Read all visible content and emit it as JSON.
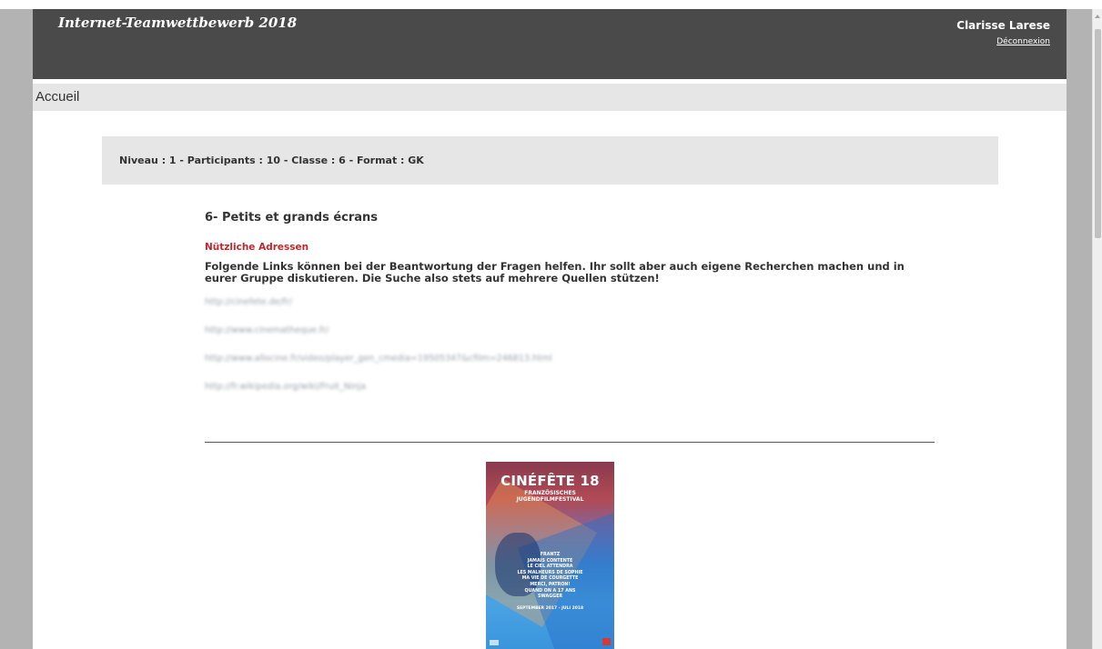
{
  "header": {
    "site_title": "Internet-Teamwettbewerb 2018",
    "user_name": "Clarisse Larese",
    "logout_label": "Déconnexion"
  },
  "nav": {
    "breadcrumb": "Accueil"
  },
  "info": {
    "text": "Niveau : 1 - Participants : 10 - Classe : 6 - Format : GK"
  },
  "content": {
    "section_title": "6- Petits et grands écrans",
    "subheading": "Nützliche Adressen",
    "intro": "Folgende Links können bei der Beantwortung der Fragen helfen. Ihr sollt aber auch eigene Recherchen machen und in eurer Gruppe diskutieren. Die Suche also stets auf mehrere Quellen stützen!",
    "links": [
      "http://cinefete.de/fr/",
      "http://www.cinematheque.fr/",
      "http://www.allocine.fr/video/player_gen_cmedia=19505347&cfilm=246813.html",
      "http://fr.wikipedia.org/wiki/Fruit_Ninja"
    ]
  },
  "poster": {
    "title": "CINÉFÊTE 18",
    "subtitle_line1": "FRANZÖSISCHES",
    "subtitle_line2": "JUGENDFILMFESTIVAL",
    "films": [
      "FRANTZ",
      "JAMAIS CONTENTE",
      "LE CIEL ATTENDRA",
      "LES MALHEURS DE SOPHIE",
      "MA VIE DE COURGETTE",
      "MERCI, PATRON!",
      "QUAND ON A 17 ANS",
      "SWAGGER"
    ],
    "dates": "SEPTEMBER 2017 - JULI 2018"
  }
}
